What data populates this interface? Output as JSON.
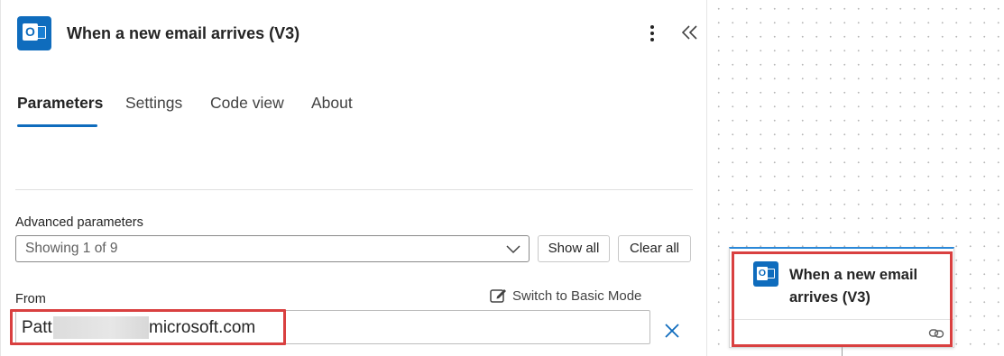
{
  "header": {
    "title": "When a new email arrives (V3)",
    "app_icon_letter": "O",
    "more_icon": "more-vertical-icon",
    "collapse_icon": "double-chevron-left-icon"
  },
  "tabs": [
    {
      "label": "Parameters",
      "active": true
    },
    {
      "label": "Settings",
      "active": false
    },
    {
      "label": "Code view",
      "active": false
    },
    {
      "label": "About",
      "active": false
    }
  ],
  "advanced": {
    "label": "Advanced parameters",
    "select_value": "Showing 1 of 9",
    "show_all_label": "Show all",
    "clear_all_label": "Clear all"
  },
  "from": {
    "label": "From",
    "value_visible_start": "Patt",
    "value_visible_end": "microsoft.com",
    "switch_mode_label": "Switch to Basic Mode"
  },
  "node": {
    "title_line1": "When a new email",
    "title_line2": "arrives (V3)",
    "icon_letter": "O",
    "link_icon": "link-icon"
  },
  "colors": {
    "accent": "#0f6cbd",
    "highlight": "#d94040",
    "text": "#242424"
  }
}
